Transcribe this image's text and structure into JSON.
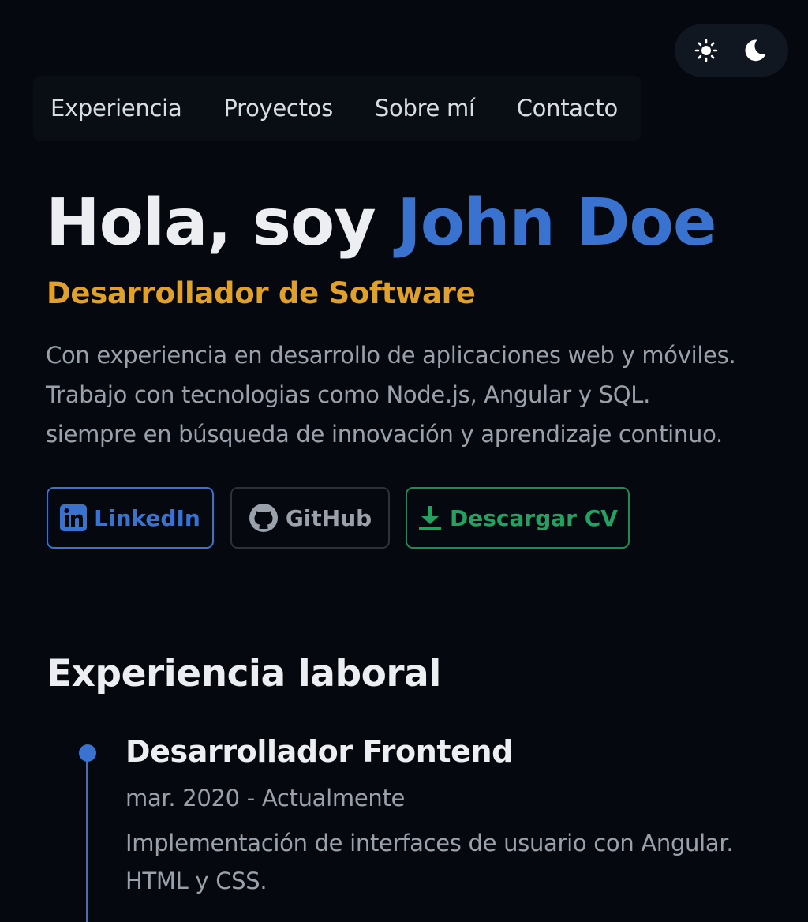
{
  "theme_toggle": {
    "light_icon": "sun-icon",
    "dark_icon": "moon-icon"
  },
  "nav": {
    "items": [
      {
        "label": "Experiencia"
      },
      {
        "label": "Proyectos"
      },
      {
        "label": "Sobre mí"
      },
      {
        "label": "Contacto"
      }
    ]
  },
  "hero": {
    "greeting": "Hola, soy",
    "name": "John Doe",
    "subtitle": "Desarrollador de Software",
    "description_lines": [
      "Con experiencia en desarrollo de aplicaciones web y móviles.",
      "Trabajo con tecnologias como Node.js, Angular y SQL.",
      "siempre en búsqueda de innovación y aprendizaje continuo."
    ]
  },
  "buttons": {
    "linkedin": {
      "label": "LinkedIn",
      "icon": "linkedin-icon"
    },
    "github": {
      "label": "GitHub",
      "icon": "github-icon"
    },
    "cv": {
      "label": "Descargar CV",
      "icon": "download-icon"
    }
  },
  "experience": {
    "title": "Experiencia laboral",
    "jobs": [
      {
        "title": "Desarrollador Frontend",
        "date": "mar. 2020 - Actualmente",
        "description_lines": [
          "Implementación de interfaces de usuario con Angular.",
          "HTML y CSS."
        ]
      }
    ]
  },
  "colors": {
    "background": "#05080f",
    "accent_blue": "#3a72cf",
    "accent_orange": "#e0a02c",
    "accent_green": "#24a060",
    "text_primary": "#eceef1",
    "text_muted": "#9ba1aa"
  }
}
